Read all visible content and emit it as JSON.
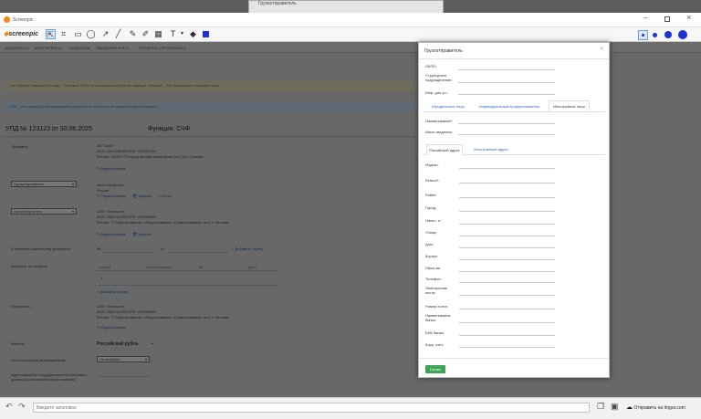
{
  "bgwindow": {
    "title": "Грузоотправитель"
  },
  "app": {
    "title": "Screenpic",
    "logo_text": "screenpic"
  },
  "nav": {
    "items": [
      "ДОКУМЕНТЫ",
      "КОНТРАГЕНТЫ",
      "ПОДПИСКИ",
      "ВВЕДЕНИЯ ВНЕ ▾",
      "ПРОВЕРКА СЕРТИФИКАТА"
    ]
  },
  "banners": {
    "warn": "The 'VatRate' attribute is invalid - The value '0.000' is invalid according to its datatype 'Decimal' - The MinInclusive constraint failed.",
    "info": "СЧФ - счет-фактура, применяемый при расчетах по налогу на добавленную стоимость"
  },
  "doc": {
    "title": "УПД № 123123  от 30.06.2025",
    "function": "Функция: СЧФ"
  },
  "seller": {
    "label": "Продавец",
    "name": "АО \"Бобр\"",
    "inn": "ИНН: 3321456789 КПП: 332344734",
    "addr": "Россия, 101000,77,город Москва,Авиаторная ул.2,141,г.Москва",
    "edit": "Редактировать"
  },
  "shipper": {
    "select": "Грузоотправитель",
    "name": "Иные сведения:",
    "country": "Россия",
    "edit": "Редактировать",
    "del": "Удалить",
    "same": "Он же"
  },
  "consignee": {
    "select": "Грузополучатель",
    "name": "ООО \"Апельсин\"",
    "inn": "ИНН: 3565752780 КПП: 220034803",
    "addr": "Россия, 77,Переяславское п,Переяславское п,Переяславское по.8 1 г.Москва",
    "edit": "Редактировать",
    "del": "Удалить"
  },
  "payment": {
    "label": "В платежно-расчетному документу",
    "from": "№",
    "date": "от",
    "add": "Добавить строку"
  },
  "shipdocs": {
    "label": "Документ об отгрузке",
    "cols": [
      "Строка",
      "Наименование",
      "№",
      "Дата"
    ],
    "row1": "1",
    "add": "Добавить строку"
  },
  "buyer": {
    "label": "Покупатель",
    "name": "ООО \"Апельсин\"",
    "inn": "ИНН: 3565752780 КПП: 220034803",
    "addr": "Россия, 77,Переяславское п,Переяславское п,Переяславское по.8 1 г.Москва",
    "edit": "Редактировать"
  },
  "currency": {
    "label": "Валюта*",
    "value": "Российский рубль"
  },
  "basis": {
    "label": "Обстоятельства формирования:",
    "value": "Не выбрано"
  },
  "govt": {
    "label": "Идентификатор государственного контракта, договора (соглашения) (при наличии):"
  },
  "dialog": {
    "title": "Грузоотправитель",
    "close": "×",
    "okpo": "ОКПО:",
    "struct": "Структурное подразделение:",
    "info": "Инф. для уч.:",
    "tabs": [
      "Юридическое лицо",
      "Индивидуальный предприниматель",
      "Иностранное лицо"
    ],
    "name": "Наименование*:",
    "other": "Иные сведения:",
    "addr_tabs": [
      "Российский адрес",
      "Иностранный адрес"
    ],
    "fields": [
      "Индекс:",
      "Регион*:",
      "Район:",
      "Город:",
      "Насел. п.:",
      "Улица:",
      "Дом:",
      "Корпус:",
      "Офис,кв:",
      "Телефон:",
      "Электронная почта:",
      "Номер счета:",
      "Наименование банка:",
      "БИК банка:",
      "Корр. счет:"
    ],
    "save": "Готово"
  },
  "bottom": {
    "placeholder": "Введите заголовок",
    "imgur": "Отправить на Imgur.com"
  },
  "colors": {
    "accent": "#1a33d6",
    "save": "#3aa655",
    "link": "#2a6bb5"
  }
}
